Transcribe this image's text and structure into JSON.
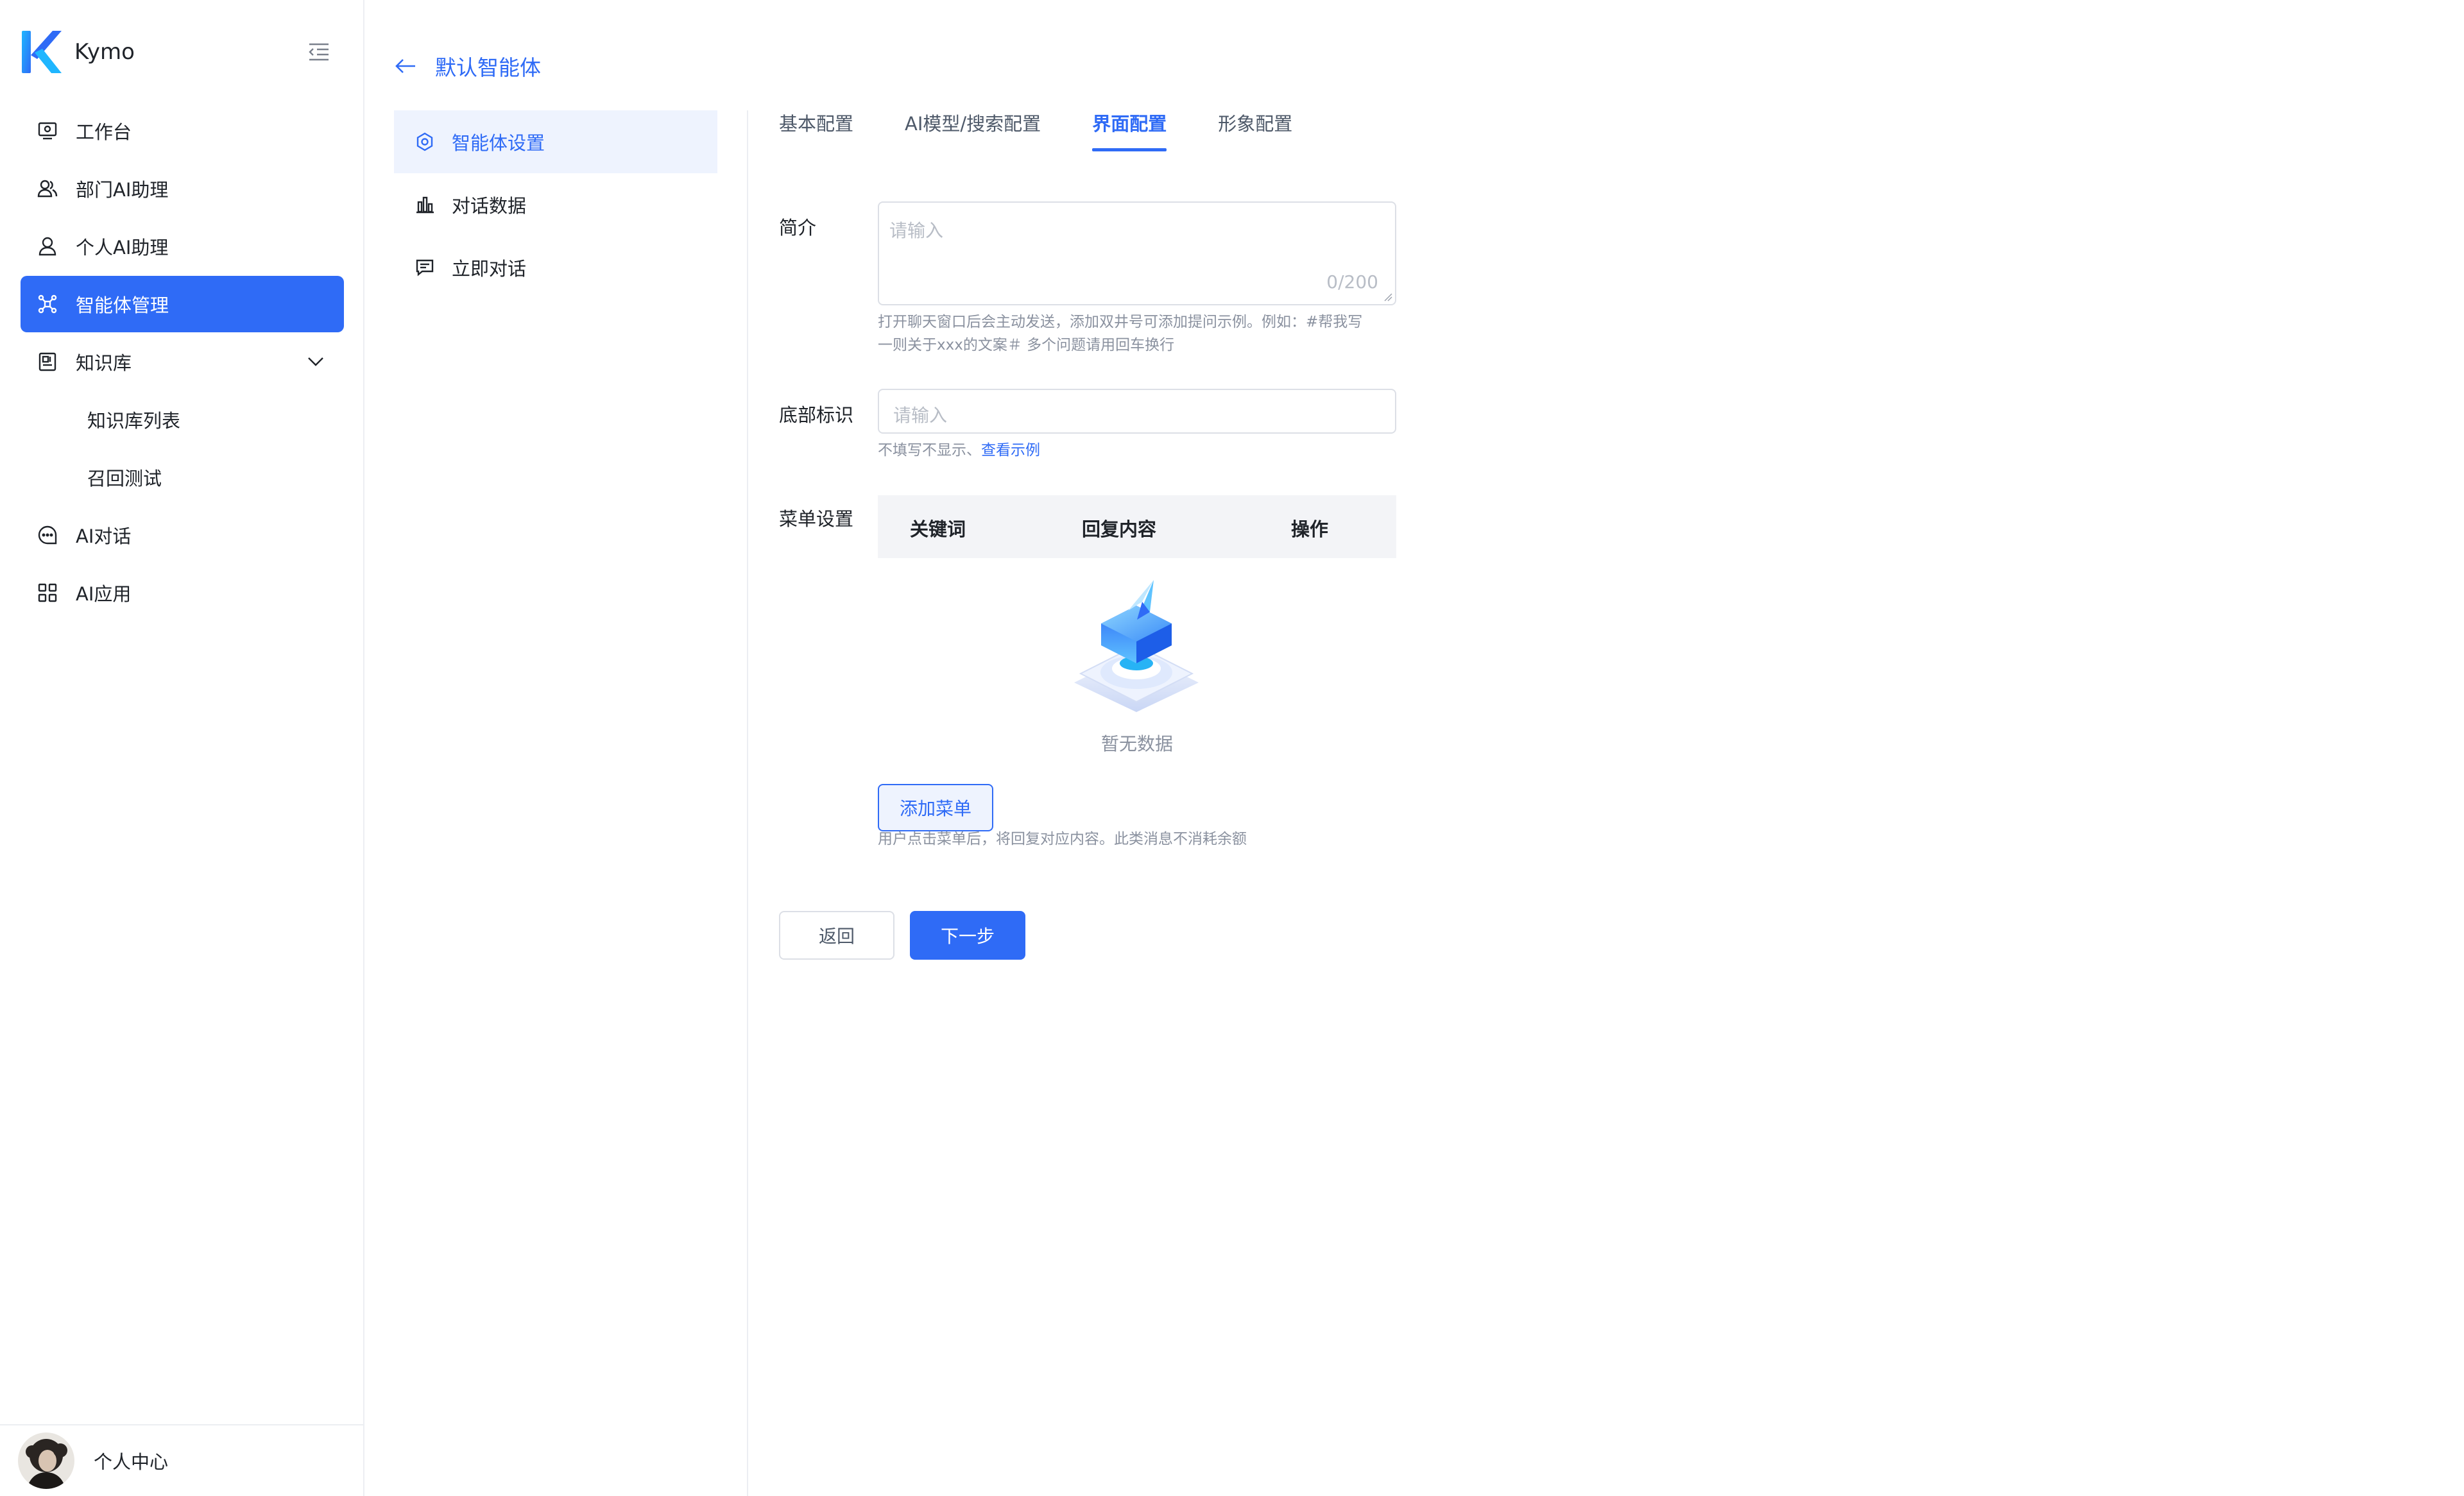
{
  "app": {
    "name": "Kymo"
  },
  "sidebar": {
    "items": [
      {
        "label": "工作台",
        "icon": "monitor-icon"
      },
      {
        "label": "部门AI助理",
        "icon": "users-icon"
      },
      {
        "label": "个人AI助理",
        "icon": "user-icon"
      },
      {
        "label": "智能体管理",
        "icon": "agent-icon",
        "active": true
      },
      {
        "label": "知识库",
        "icon": "book-icon",
        "expanded": true
      },
      {
        "label": "知识库列表",
        "sub": true
      },
      {
        "label": "召回测试",
        "sub": true
      },
      {
        "label": "AI对话",
        "icon": "chat-icon"
      },
      {
        "label": "AI应用",
        "icon": "grid-icon"
      }
    ],
    "footer": {
      "label": "个人中心"
    }
  },
  "header": {
    "title": "默认智能体"
  },
  "submenu": {
    "items": [
      {
        "label": "智能体设置",
        "icon": "settings-icon",
        "active": true
      },
      {
        "label": "对话数据",
        "icon": "bar-chart-icon"
      },
      {
        "label": "立即对话",
        "icon": "message-icon"
      }
    ]
  },
  "tabs": [
    {
      "label": "基本配置"
    },
    {
      "label": "AI模型/搜索配置"
    },
    {
      "label": "界面配置",
      "active": true
    },
    {
      "label": "形象配置"
    }
  ],
  "form": {
    "intro": {
      "label": "简介",
      "placeholder": "请输入",
      "counter": "0/200",
      "hint_line1": "打开聊天窗口后会主动发送，添加双井号可添加提问示例。例如：#帮我写",
      "hint_line2": "一则关于xxx的文案＃ 多个问题请用回车换行"
    },
    "footer_mark": {
      "label": "底部标识",
      "placeholder": "请输入",
      "hint": "不填写不显示、",
      "hint_link": "查看示例"
    },
    "menu": {
      "label": "菜单设置",
      "columns": [
        "关键词",
        "回复内容",
        "操作"
      ],
      "empty_text": "暂无数据",
      "add_button": "添加菜单",
      "hint": "用户点击菜单后，将回复对应内容。此类消息不消耗余额"
    }
  },
  "actions": {
    "back": "返回",
    "next": "下一步"
  },
  "colors": {
    "primary": "#2f6bf6",
    "active_bg": "#eef3fe",
    "border": "#dcdfe6"
  }
}
